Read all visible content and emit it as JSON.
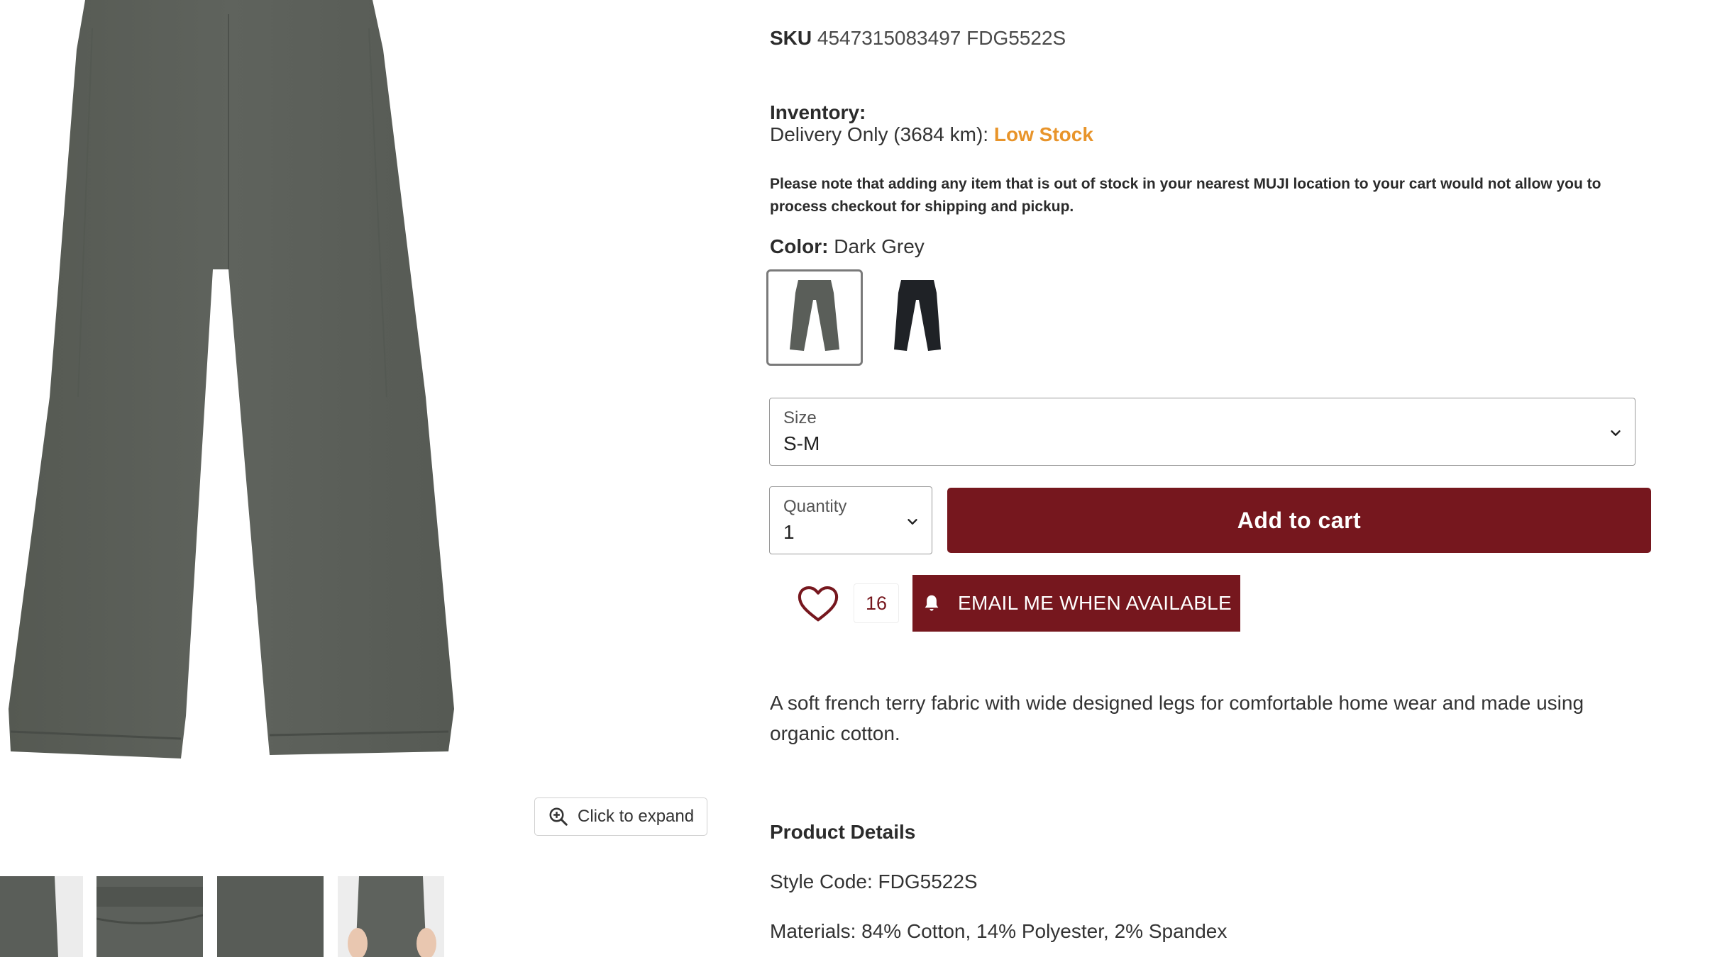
{
  "sku": {
    "label": "SKU",
    "value": "4547315083497 FDG5522S"
  },
  "inventory": {
    "label": "Inventory:",
    "delivery_text": "Delivery Only (3684 km):",
    "status": "Low Stock"
  },
  "stock_note": "Please note that adding any item that is out of stock in your nearest MUJI location to your cart would not allow you to process checkout for shipping and pickup.",
  "color": {
    "label": "Color:",
    "selected": "Dark Grey",
    "swatches": [
      {
        "name": "Dark Grey",
        "hex": "#5a5e59",
        "selected": true
      },
      {
        "name": "Black",
        "hex": "#1f2226",
        "selected": false
      }
    ]
  },
  "size": {
    "label": "Size",
    "value": "S-M"
  },
  "quantity": {
    "label": "Quantity",
    "value": "1"
  },
  "add_to_cart_label": "Add to cart",
  "wishlist_count": "16",
  "email_button_label": "EMAIL ME WHEN AVAILABLE",
  "gallery": {
    "expand_label": "Click to expand"
  },
  "description": "A soft french terry fabric with wide designed legs for comfortable home wear and made using organic cotton.",
  "product_details": {
    "heading": "Product Details",
    "style_code": "Style Code: FDG5522S",
    "materials": "Materials: 84% Cotton, 14% Polyester, 2% Spandex"
  },
  "colors": {
    "accent": "#76171e",
    "low_stock": "#e8942a",
    "pants_dark_grey": "#5a5e59"
  }
}
